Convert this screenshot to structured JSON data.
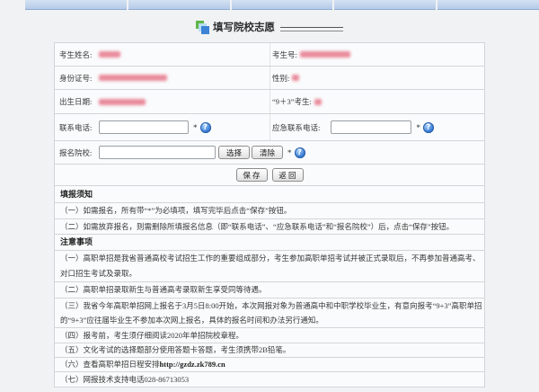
{
  "page": {
    "title": "填写院校志愿"
  },
  "colors": {
    "nav_tab": "#b5cbe8",
    "help_icon": "#2e72cf",
    "redacted_value": "#e25b72",
    "border": "#d2d5d9",
    "title_icon_green": "#5fb648",
    "title_icon_blue": "#3c83d6"
  },
  "icons": {
    "title": "form-icon",
    "help": "help-icon",
    "help_glyph": "?"
  },
  "form": {
    "required_mark": "*",
    "fields": {
      "name": {
        "label": "考生姓名:"
      },
      "exam_no": {
        "label": "考生号:"
      },
      "id_no": {
        "label": "身份证号:"
      },
      "gender": {
        "label": "性别:"
      },
      "birth_date": {
        "label": "出生日期:"
      },
      "nine_plus_three": {
        "label": "“9＋3”考生:"
      },
      "phone": {
        "label": "联系电话:",
        "value": ""
      },
      "emergency_phone": {
        "label": "应急联系电话:",
        "value": ""
      },
      "school": {
        "label": "报名院校:",
        "value": ""
      }
    },
    "buttons": {
      "select": "选择",
      "clear": "清除",
      "save": "保 存",
      "back": "返 回"
    }
  },
  "instructions": {
    "title": "填报须知",
    "items": [
      "（一）如需报名，所有带“*”为必填项，填写完毕后点击“保存”按钮。",
      "（二）如需放弃报名，则需删除所填报名信息（即“联系电话”、“应急联系电话”和“报名院校”）后，点击“保存”按钮。"
    ]
  },
  "notes": {
    "title": "注意事项",
    "items": [
      {
        "text": "（一）高职单招是我省普通高校考试招生工作的重要组成部分，考生参加高职单招考试并被正式录取后，不再参加普通高考、对口招生考试及录取。"
      },
      {
        "text": "（二）高职单招录取新生与普通高考录取新生享受同等待遇。"
      },
      {
        "text": "（三）我省今年高职单招网上报名于3月5日8:00开始，本次网报对象为普通高中和中职学校毕业生，有意向报考“9+3”高职单招的“9+3”应往届毕业生不参加本次网上报名，具体的报名时间和办法另行通知。"
      },
      {
        "text": "（四）报考前，考生须仔细阅读2020年单招院校章程。"
      },
      {
        "text": "（五）文化考试的选择题部分使用答题卡答题，考生须携带2B铅笔。"
      },
      {
        "text": "（六）查看高职单招日程安排",
        "link": "http://gzdz.zk789.cn"
      },
      {
        "text": "（七）网报技术支持电话028-86713053"
      }
    ]
  }
}
